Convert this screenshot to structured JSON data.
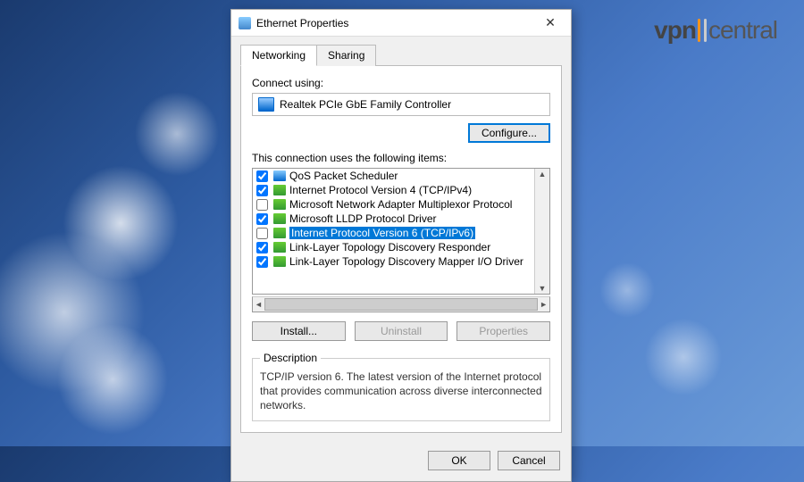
{
  "logo": {
    "part1": "vpn",
    "part2": "central"
  },
  "dialog": {
    "title": "Ethernet Properties",
    "tabs": {
      "networking": "Networking",
      "sharing": "Sharing"
    },
    "connect_label": "Connect using:",
    "adapter": "Realtek PCIe GbE Family Controller",
    "configure": "Configure...",
    "items_label": "This connection uses the following items:",
    "items": [
      {
        "checked": true,
        "icon": "blue",
        "label": "QoS Packet Scheduler",
        "selected": false
      },
      {
        "checked": true,
        "icon": "green",
        "label": "Internet Protocol Version 4 (TCP/IPv4)",
        "selected": false
      },
      {
        "checked": false,
        "icon": "green",
        "label": "Microsoft Network Adapter Multiplexor Protocol",
        "selected": false
      },
      {
        "checked": true,
        "icon": "green",
        "label": "Microsoft LLDP Protocol Driver",
        "selected": false
      },
      {
        "checked": false,
        "icon": "green",
        "label": "Internet Protocol Version 6 (TCP/IPv6)",
        "selected": true
      },
      {
        "checked": true,
        "icon": "green",
        "label": "Link-Layer Topology Discovery Responder",
        "selected": false
      },
      {
        "checked": true,
        "icon": "green",
        "label": "Link-Layer Topology Discovery Mapper I/O Driver",
        "selected": false
      }
    ],
    "install": "Install...",
    "uninstall": "Uninstall",
    "properties": "Properties",
    "desc_legend": "Description",
    "desc_text": "TCP/IP version 6. The latest version of the Internet protocol that provides communication across diverse interconnected networks.",
    "ok": "OK",
    "cancel": "Cancel"
  }
}
